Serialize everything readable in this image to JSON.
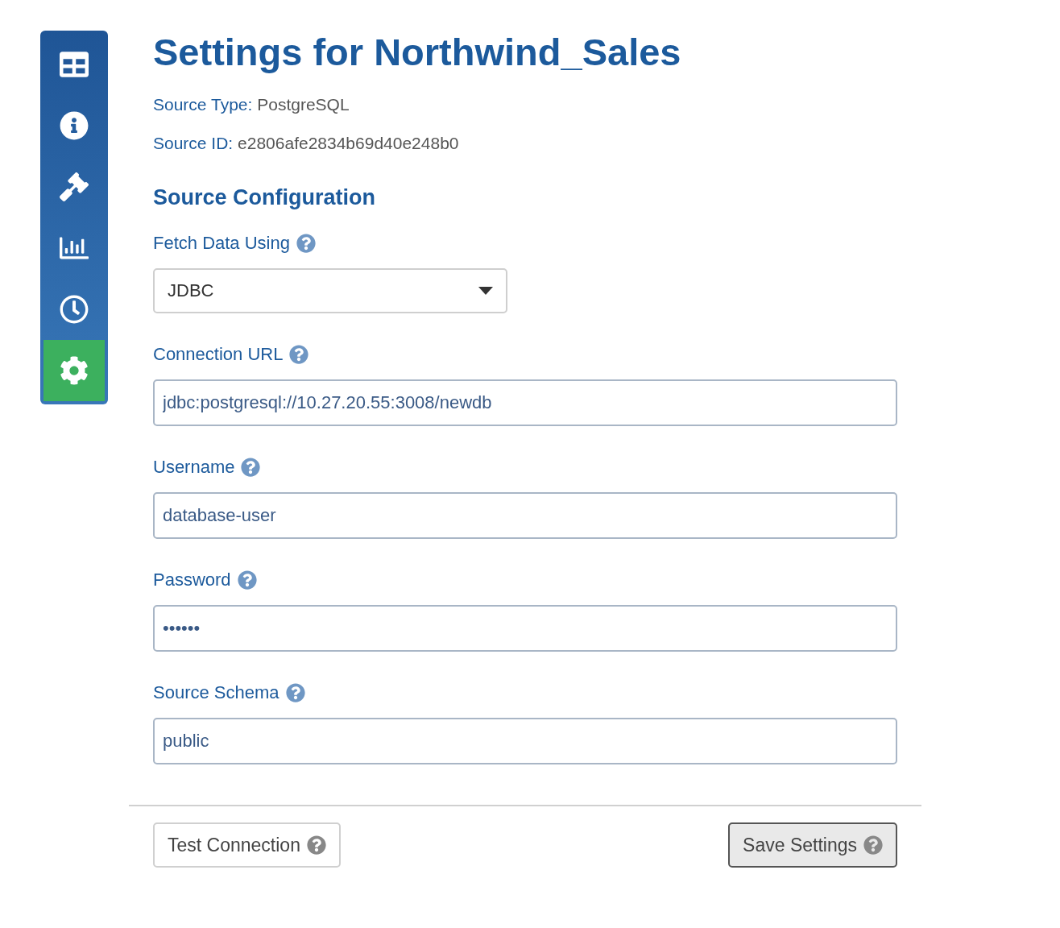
{
  "sidebar": {
    "items": [
      {
        "selected": false
      },
      {
        "selected": false
      },
      {
        "selected": false
      },
      {
        "selected": false
      },
      {
        "selected": false
      },
      {
        "selected": true
      }
    ]
  },
  "title": "Settings for Northwind_Sales",
  "meta": [
    {
      "label": "Source Type:",
      "value": "PostgreSQL"
    },
    {
      "label": "Source ID:",
      "value": "e2806afe2834b69d40e248b0"
    }
  ],
  "section_title": "Source Configuration",
  "fields": [
    {
      "kind": "select",
      "label": "Fetch Data Using",
      "value": "JDBC"
    },
    {
      "kind": "text",
      "label": "Connection URL",
      "value": "jdbc:postgresql://10.27.20.55:3008/newdb"
    },
    {
      "kind": "text",
      "label": "Username",
      "value": "database-user"
    },
    {
      "kind": "text",
      "label": "Password",
      "value": "••••••"
    },
    {
      "kind": "text",
      "label": "Source Schema",
      "value": "public"
    }
  ],
  "buttons": [
    {
      "label": "Test Connection",
      "kind": "default"
    },
    {
      "label": "Save Settings",
      "kind": "primary"
    }
  ]
}
